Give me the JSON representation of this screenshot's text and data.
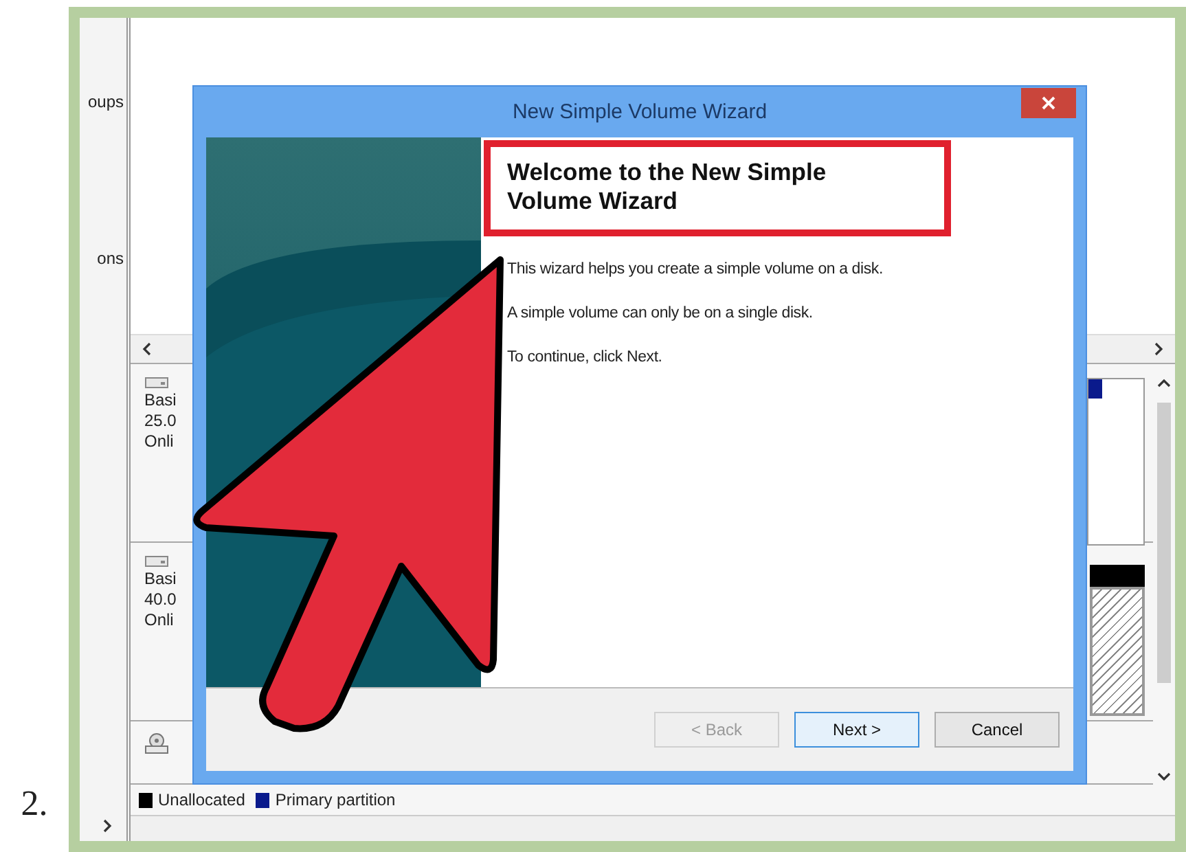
{
  "step_number": "2.",
  "background_window": {
    "left_pane": {
      "items": [
        "oups",
        "ons"
      ]
    },
    "disks": [
      {
        "kind": "disk",
        "lines": [
          "Basi",
          "25.0",
          "Onli"
        ]
      },
      {
        "kind": "disk",
        "lines": [
          "Basi",
          "40.0",
          "Onli"
        ]
      },
      {
        "kind": "cdrom"
      }
    ],
    "legend": [
      {
        "label": "Unallocated",
        "color": "#000000"
      },
      {
        "label": "Primary partition",
        "color": "#0a1a8c"
      }
    ]
  },
  "dialog": {
    "title": "New Simple Volume Wizard",
    "heading": "Welcome to the New Simple Volume Wizard",
    "paragraphs": [
      "This wizard helps you create a simple volume on a disk.",
      "A simple volume can only be on a single disk.",
      "To continue, click Next."
    ],
    "buttons": [
      {
        "label": "< Back",
        "disabled": true,
        "focused": false
      },
      {
        "label": "Next >",
        "disabled": false,
        "focused": true
      },
      {
        "label": "Cancel",
        "disabled": false,
        "focused": false
      }
    ]
  }
}
